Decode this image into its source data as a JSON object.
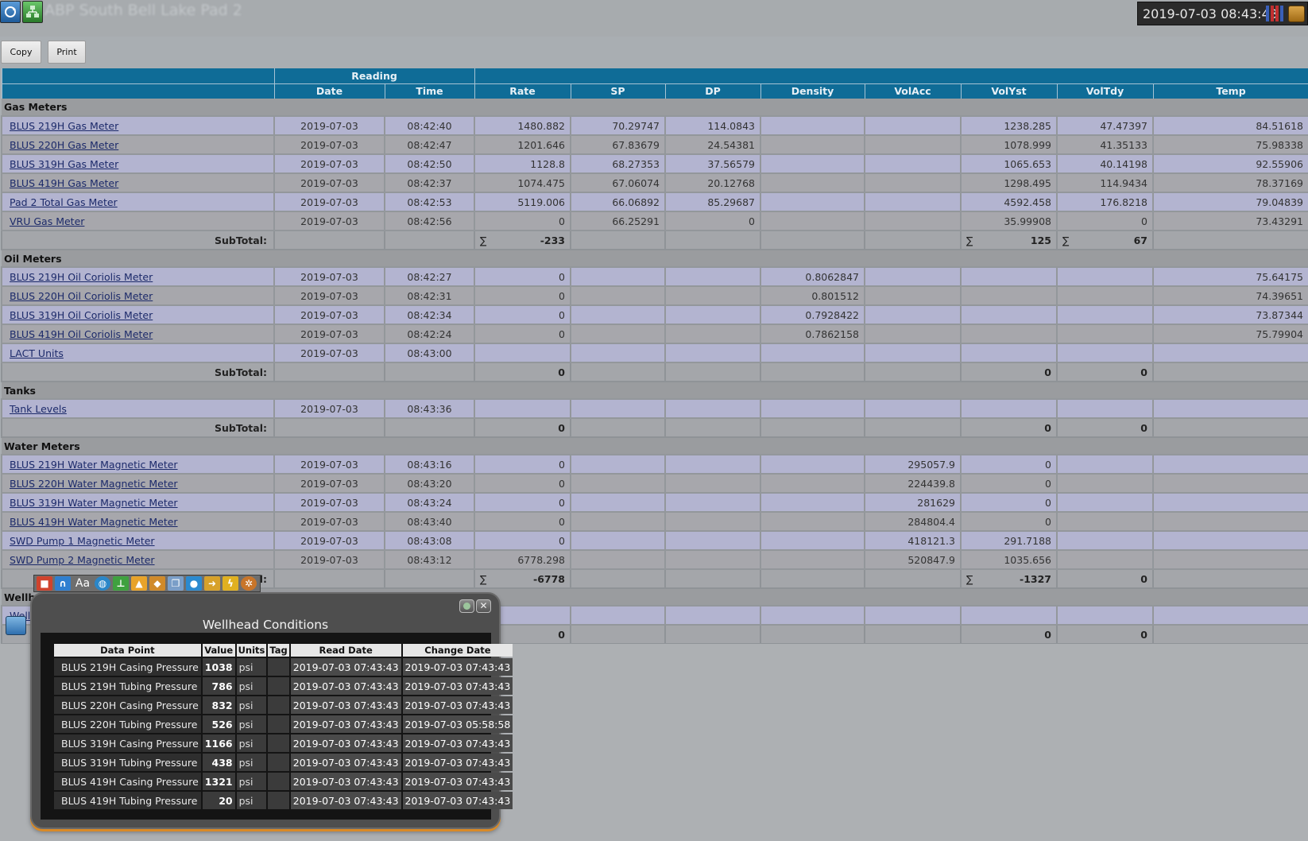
{
  "header": {
    "page_title": "ABP South Bell Lake Pad 2",
    "clock": "2019-07-03 08:43:43",
    "copy_label": "Copy",
    "print_label": "Print"
  },
  "colors": {
    "header_blue": "#0f6c97",
    "row_light": "#b3b4d0",
    "row_dark": "#a7a7ac",
    "section": "#9a9c9f",
    "dialog_bg": "#4e4e4e",
    "dialog_accent": "#d98a27"
  },
  "table": {
    "group_header": "Reading",
    "columns": {
      "name": "",
      "date": "Date",
      "time": "Time",
      "rate": "Rate",
      "sp": "SP",
      "dp": "DP",
      "density": "Density",
      "volacc": "VolAcc",
      "volyst": "VolYst",
      "voltdy": "VolTdy",
      "temp": "Temp"
    },
    "sections": [
      {
        "title": "Gas Meters",
        "rows": [
          {
            "name": "BLUS 219H Gas Meter",
            "date": "2019-07-03",
            "time": "08:42:40",
            "rate": "1480.882",
            "sp": "70.29747",
            "dp": "114.0843",
            "density": "",
            "volacc": "",
            "volyst": "1238.285",
            "voltdy": "47.47397",
            "temp": "84.51618"
          },
          {
            "name": "BLUS 220H Gas Meter",
            "date": "2019-07-03",
            "time": "08:42:47",
            "rate": "1201.646",
            "sp": "67.83679",
            "dp": "24.54381",
            "density": "",
            "volacc": "",
            "volyst": "1078.999",
            "voltdy": "41.35133",
            "temp": "75.98338"
          },
          {
            "name": "BLUS 319H Gas Meter",
            "date": "2019-07-03",
            "time": "08:42:50",
            "rate": "1128.8",
            "sp": "68.27353",
            "dp": "37.56579",
            "density": "",
            "volacc": "",
            "volyst": "1065.653",
            "voltdy": "40.14198",
            "temp": "92.55906"
          },
          {
            "name": "BLUS 419H Gas Meter",
            "date": "2019-07-03",
            "time": "08:42:37",
            "rate": "1074.475",
            "sp": "67.06074",
            "dp": "20.12768",
            "density": "",
            "volacc": "",
            "volyst": "1298.495",
            "voltdy": "114.9434",
            "temp": "78.37169"
          },
          {
            "name": "Pad 2 Total Gas Meter",
            "date": "2019-07-03",
            "time": "08:42:53",
            "rate": "5119.006",
            "sp": "66.06892",
            "dp": "85.29687",
            "density": "",
            "volacc": "",
            "volyst": "4592.458",
            "voltdy": "176.8218",
            "temp": "79.04839"
          },
          {
            "name": "VRU Gas Meter",
            "date": "2019-07-03",
            "time": "08:42:56",
            "rate": "0",
            "sp": "66.25291",
            "dp": "0",
            "density": "",
            "volacc": "",
            "volyst": "35.99908",
            "voltdy": "0",
            "temp": "73.43291"
          }
        ],
        "subtotal": {
          "label": "SubTotal:",
          "rate": "-233",
          "rate_sigma": "∑",
          "volyst": "125",
          "volyst_sigma": "∑",
          "voltdy": "67",
          "voltdy_sigma": "∑"
        }
      },
      {
        "title": "Oil Meters",
        "rows": [
          {
            "name": "BLUS 219H Oil Coriolis Meter",
            "date": "2019-07-03",
            "time": "08:42:27",
            "rate": "0",
            "sp": "",
            "dp": "",
            "density": "0.8062847",
            "volacc": "",
            "volyst": "",
            "voltdy": "",
            "temp": "75.64175"
          },
          {
            "name": "BLUS 220H Oil Coriolis Meter",
            "date": "2019-07-03",
            "time": "08:42:31",
            "rate": "0",
            "sp": "",
            "dp": "",
            "density": "0.801512",
            "volacc": "",
            "volyst": "",
            "voltdy": "",
            "temp": "74.39651"
          },
          {
            "name": "BLUS 319H Oil Coriolis Meter",
            "date": "2019-07-03",
            "time": "08:42:34",
            "rate": "0",
            "sp": "",
            "dp": "",
            "density": "0.7928422",
            "volacc": "",
            "volyst": "",
            "voltdy": "",
            "temp": "73.87344"
          },
          {
            "name": "BLUS 419H Oil Coriolis Meter",
            "date": "2019-07-03",
            "time": "08:42:24",
            "rate": "0",
            "sp": "",
            "dp": "",
            "density": "0.7862158",
            "volacc": "",
            "volyst": "",
            "voltdy": "",
            "temp": "75.79904"
          },
          {
            "name": "LACT Units",
            "date": "2019-07-03",
            "time": "08:43:00",
            "rate": "",
            "sp": "",
            "dp": "",
            "density": "",
            "volacc": "",
            "volyst": "",
            "voltdy": "",
            "temp": ""
          }
        ],
        "subtotal": {
          "label": "SubTotal:",
          "rate": "0",
          "rate_sigma": "",
          "volyst": "0",
          "volyst_sigma": "",
          "voltdy": "0",
          "voltdy_sigma": ""
        }
      },
      {
        "title": "Tanks",
        "rows": [
          {
            "name": "Tank Levels",
            "date": "2019-07-03",
            "time": "08:43:36",
            "rate": "",
            "sp": "",
            "dp": "",
            "density": "",
            "volacc": "",
            "volyst": "",
            "voltdy": "",
            "temp": ""
          }
        ],
        "subtotal": {
          "label": "SubTotal:",
          "rate": "0",
          "rate_sigma": "",
          "volyst": "0",
          "volyst_sigma": "",
          "voltdy": "0",
          "voltdy_sigma": ""
        }
      },
      {
        "title": "Water Meters",
        "rows": [
          {
            "name": "BLUS 219H Water Magnetic Meter",
            "date": "2019-07-03",
            "time": "08:43:16",
            "rate": "0",
            "sp": "",
            "dp": "",
            "density": "",
            "volacc": "295057.9",
            "volyst": "0",
            "voltdy": "",
            "temp": ""
          },
          {
            "name": "BLUS 220H Water Magnetic Meter",
            "date": "2019-07-03",
            "time": "08:43:20",
            "rate": "0",
            "sp": "",
            "dp": "",
            "density": "",
            "volacc": "224439.8",
            "volyst": "0",
            "voltdy": "",
            "temp": ""
          },
          {
            "name": "BLUS 319H Water Magnetic Meter",
            "date": "2019-07-03",
            "time": "08:43:24",
            "rate": "0",
            "sp": "",
            "dp": "",
            "density": "",
            "volacc": "281629",
            "volyst": "0",
            "voltdy": "",
            "temp": ""
          },
          {
            "name": "BLUS 419H Water Magnetic Meter",
            "date": "2019-07-03",
            "time": "08:43:40",
            "rate": "0",
            "sp": "",
            "dp": "",
            "density": "",
            "volacc": "284804.4",
            "volyst": "0",
            "voltdy": "",
            "temp": ""
          },
          {
            "name": "SWD Pump 1 Magnetic Meter",
            "date": "2019-07-03",
            "time": "08:43:08",
            "rate": "0",
            "sp": "",
            "dp": "",
            "density": "",
            "volacc": "418121.3",
            "volyst": "291.7188",
            "voltdy": "",
            "temp": ""
          },
          {
            "name": "SWD Pump 2 Magnetic Meter",
            "date": "2019-07-03",
            "time": "08:43:12",
            "rate": "6778.298",
            "sp": "",
            "dp": "",
            "density": "",
            "volacc": "520847.9",
            "volyst": "1035.656",
            "voltdy": "",
            "temp": ""
          }
        ],
        "subtotal": {
          "label": "SubTotal:",
          "rate": "-6778",
          "rate_sigma": "∑",
          "volyst": "-1327",
          "volyst_sigma": "∑",
          "voltdy": "0",
          "voltdy_sigma": ""
        }
      },
      {
        "title": "Wellhead",
        "rows": [
          {
            "name": "Well",
            "date": "",
            "time": "",
            "rate": "",
            "sp": "",
            "dp": "",
            "density": "",
            "volacc": "",
            "volyst": "",
            "voltdy": "",
            "temp": ""
          }
        ],
        "subtotal": {
          "label": "SubTotal:",
          "rate": "0",
          "rate_sigma": "",
          "volyst": "0",
          "volyst_sigma": "",
          "voltdy": "0",
          "voltdy_sigma": ""
        }
      }
    ]
  },
  "toolbar": {
    "icons": [
      "stop-icon",
      "magnet-icon",
      "font-icon",
      "globe-icon",
      "tree-icon",
      "fire-icon",
      "tag-icon",
      "copy-icon",
      "camera-icon",
      "export-icon",
      "lightning-icon",
      "gear-icon"
    ],
    "font_label": "Aa"
  },
  "dialog": {
    "title": "Wellhead Conditions",
    "columns": {
      "data_point": "Data Point",
      "value": "Value",
      "units": "Units",
      "tag": "Tag",
      "read_date": "Read Date",
      "change_date": "Change Date"
    },
    "rows": [
      {
        "data_point": "BLUS 219H Casing Pressure",
        "value": "1038",
        "units": "psi",
        "tag": "",
        "read_date": "2019-07-03 07:43:43",
        "change_date": "2019-07-03 07:43:43"
      },
      {
        "data_point": "BLUS 219H Tubing Pressure",
        "value": "786",
        "units": "psi",
        "tag": "",
        "read_date": "2019-07-03 07:43:43",
        "change_date": "2019-07-03 07:43:43"
      },
      {
        "data_point": "BLUS 220H Casing Pressure",
        "value": "832",
        "units": "psi",
        "tag": "",
        "read_date": "2019-07-03 07:43:43",
        "change_date": "2019-07-03 07:43:43"
      },
      {
        "data_point": "BLUS 220H Tubing Pressure",
        "value": "526",
        "units": "psi",
        "tag": "",
        "read_date": "2019-07-03 07:43:43",
        "change_date": "2019-07-03 05:58:58"
      },
      {
        "data_point": "BLUS 319H Casing Pressure",
        "value": "1166",
        "units": "psi",
        "tag": "",
        "read_date": "2019-07-03 07:43:43",
        "change_date": "2019-07-03 07:43:43"
      },
      {
        "data_point": "BLUS 319H Tubing Pressure",
        "value": "438",
        "units": "psi",
        "tag": "",
        "read_date": "2019-07-03 07:43:43",
        "change_date": "2019-07-03 07:43:43"
      },
      {
        "data_point": "BLUS 419H Casing Pressure",
        "value": "1321",
        "units": "psi",
        "tag": "",
        "read_date": "2019-07-03 07:43:43",
        "change_date": "2019-07-03 07:43:43"
      },
      {
        "data_point": "BLUS 419H Tubing Pressure",
        "value": "20",
        "units": "psi",
        "tag": "",
        "read_date": "2019-07-03 07:43:43",
        "change_date": "2019-07-03 07:43:43"
      }
    ]
  }
}
